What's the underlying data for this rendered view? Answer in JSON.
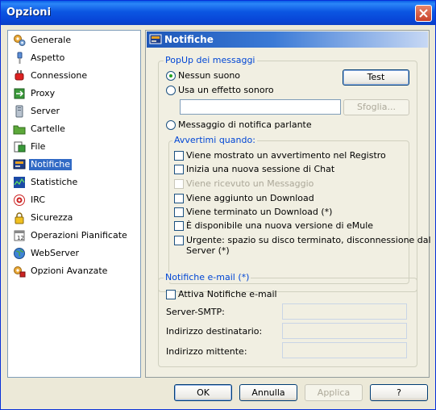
{
  "window": {
    "title": "Opzioni"
  },
  "sidebar": {
    "items": [
      {
        "label": "Generale",
        "icon": "gears-icon"
      },
      {
        "label": "Aspetto",
        "icon": "screwdriver-icon"
      },
      {
        "label": "Connessione",
        "icon": "plug-icon"
      },
      {
        "label": "Proxy",
        "icon": "proxy-icon"
      },
      {
        "label": "Server",
        "icon": "server-icon"
      },
      {
        "label": "Cartelle",
        "icon": "folder-icon"
      },
      {
        "label": "File",
        "icon": "file-icon"
      },
      {
        "label": "Notifiche",
        "icon": "notification-icon",
        "selected": true
      },
      {
        "label": "Statistiche",
        "icon": "statistics-icon"
      },
      {
        "label": "IRC",
        "icon": "irc-icon"
      },
      {
        "label": "Sicurezza",
        "icon": "lock-icon"
      },
      {
        "label": "Operazioni Pianificate",
        "icon": "calendar-icon"
      },
      {
        "label": "WebServer",
        "icon": "globe-icon"
      },
      {
        "label": "Opzioni Avanzate",
        "icon": "advanced-options-icon"
      }
    ]
  },
  "panel": {
    "title": "Notifiche",
    "popup": {
      "legend": "PopUp dei messaggi",
      "no_sound": "Nessun suono",
      "sound_effect": "Usa un effetto sonoro",
      "test_button": "Test",
      "browse_button": "Sfoglia...",
      "sound_path": "",
      "speaking": "Messaggio di notifica parlante",
      "selected_option": "Nessun suono"
    },
    "warn": {
      "legend": "Avvertimi quando:",
      "items": [
        {
          "label": "Viene mostrato un avvertimento nel Registro",
          "disabled": false
        },
        {
          "label": "Inizia una nuova sessione di Chat",
          "disabled": false
        },
        {
          "label": "Viene ricevuto un Messaggio",
          "disabled": true
        },
        {
          "label": "Viene aggiunto un Download",
          "disabled": false
        },
        {
          "label": "Viene terminato un Download (*)",
          "disabled": false
        },
        {
          "label": "È disponibile una nuova versione di eMule",
          "disabled": false
        },
        {
          "label": "Urgente: spazio su disco terminato, disconnessione dal",
          "label2": "Server (*)",
          "disabled": false
        }
      ]
    },
    "email": {
      "legend": "Notifiche e-mail (*)",
      "enable": "Attiva Notifiche e-mail",
      "smtp_label": "Server-SMTP:",
      "to_label": "Indirizzo destinatario:",
      "from_label": "Indirizzo mittente:",
      "smtp_value": "",
      "to_value": "",
      "from_value": ""
    }
  },
  "footer": {
    "ok": "OK",
    "cancel": "Annulla",
    "apply": "Applica",
    "help": "?"
  }
}
